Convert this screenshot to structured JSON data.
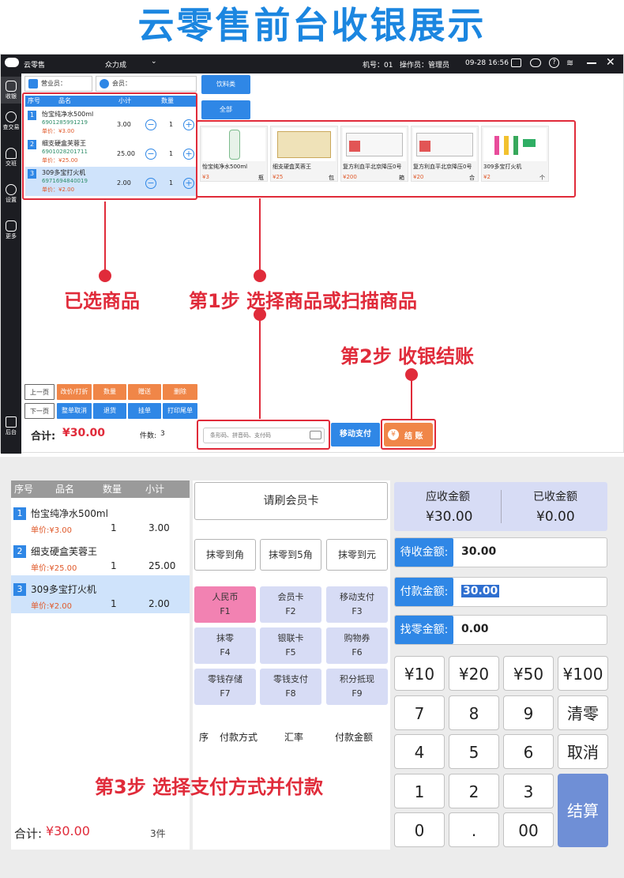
{
  "hero_title": "云零售前台收银展示",
  "app": {
    "name": "云零售",
    "store": "众力成",
    "machine": "机号：01",
    "operator": "操作员：管理员",
    "datetime": "09-28 16:56"
  },
  "sidenav": [
    {
      "label": "收银"
    },
    {
      "label": "查交易"
    },
    {
      "label": "交班"
    },
    {
      "label": "设置"
    },
    {
      "label": "更多"
    },
    {
      "label": "后台"
    }
  ],
  "fields": {
    "salesperson": "营业员：",
    "member": "会员："
  },
  "categories": {
    "drinks": "饮料类",
    "all": "全部"
  },
  "cart": {
    "headers": {
      "no": "序号",
      "name": "品名",
      "subtotal": "小计",
      "qty": "数量"
    },
    "items": [
      {
        "no": "1",
        "name": "怡宝纯净水500ml",
        "code": "6901285991219",
        "unit_price": "单价：¥3.00",
        "subtotal": "3.00",
        "qty": "1"
      },
      {
        "no": "2",
        "name": "细支硬盒芙蓉王",
        "code": "6901028201711",
        "unit_price": "单价：¥25.00",
        "subtotal": "25.00",
        "qty": "1"
      },
      {
        "no": "3",
        "name": "309多宝打火机",
        "code": "6971694840019",
        "unit_price": "单价：¥2.00",
        "subtotal": "2.00",
        "qty": "1"
      }
    ],
    "minus": "−",
    "plus": "+"
  },
  "products": [
    {
      "name": "怡宝纯净水500ml",
      "price": "¥3",
      "unit": "瓶"
    },
    {
      "name": "细支硬盒芙蓉王",
      "price": "¥25",
      "unit": "包"
    },
    {
      "name": "复方利血平北京降压0号",
      "price": "¥200",
      "unit": "箱"
    },
    {
      "name": "复方利血平北京降压0号",
      "price": "¥20",
      "unit": "合"
    },
    {
      "name": "309多宝打火机",
      "price": "¥2",
      "unit": "个"
    }
  ],
  "annotations": {
    "selected": "已选商品",
    "step1": "第1步 选择商品或扫描商品",
    "step2": "第2步 收银结账",
    "step3": "第3步 选择支付方式并付款"
  },
  "func_buttons": {
    "prev": "上一页",
    "next": "下一页",
    "change_price": "改价/打折",
    "qty": "数量",
    "gift": "赠送",
    "delete": "删除",
    "cancel_order": "整单取消",
    "return": "退货",
    "hang": "挂单",
    "print": "打印尾单"
  },
  "totals": {
    "label": "合计:",
    "amount": "¥30.00",
    "count_label": "件数:",
    "count": "3"
  },
  "scan": {
    "placeholder": "条形码、拼音码、支付码"
  },
  "mobile_pay": "移动支付",
  "checkout": {
    "icon": "¥",
    "label": "结 账"
  },
  "pay_screen": {
    "headers": {
      "no": "序号",
      "name": "品名",
      "qty": "数量",
      "subtotal": "小计"
    },
    "items": [
      {
        "no": "1",
        "name": "怡宝纯净水500ml",
        "unit_price": "单价:¥3.00",
        "qty": "1",
        "subtotal": "3.00"
      },
      {
        "no": "2",
        "name": "细支硬盒芙蓉王",
        "unit_price": "单价:¥25.00",
        "qty": "1",
        "subtotal": "25.00"
      },
      {
        "no": "3",
        "name": "309多宝打火机",
        "unit_price": "单价:¥2.00",
        "qty": "1",
        "subtotal": "2.00"
      }
    ],
    "total_label": "合计:",
    "total": "¥30.00",
    "count": "3件",
    "member_card": "请刷会员卡",
    "rounding": [
      "抹零到角",
      "抹零到5角",
      "抹零到元"
    ],
    "methods": [
      {
        "name": "人民币",
        "key": "F1"
      },
      {
        "name": "会员卡",
        "key": "F2"
      },
      {
        "name": "移动支付",
        "key": "F3"
      },
      {
        "name": "抹零",
        "key": "F4"
      },
      {
        "name": "银联卡",
        "key": "F5"
      },
      {
        "name": "购物券",
        "key": "F6"
      },
      {
        "name": "零钱存储",
        "key": "F7"
      },
      {
        "name": "零钱支付",
        "key": "F8"
      },
      {
        "name": "积分抵现",
        "key": "F9"
      }
    ],
    "pay_headers": {
      "no": "序",
      "method": "付款方式",
      "rate": "汇率",
      "amount": "付款金额"
    },
    "receivable_label": "应收金额",
    "receivable": "¥30.00",
    "received_label": "已收金额",
    "received": "¥0.00",
    "pending_label": "待收金额:",
    "pending": "30.00",
    "paid_label": "付款金额:",
    "paid": "30.00",
    "change_label": "找零金额:",
    "change": "0.00",
    "keys": [
      "¥10",
      "¥20",
      "¥50",
      "¥100",
      "7",
      "8",
      "9",
      "清零",
      "4",
      "5",
      "6",
      "取消",
      "1",
      "2",
      "3",
      "0",
      ".",
      "00"
    ],
    "settle": "结算"
  }
}
